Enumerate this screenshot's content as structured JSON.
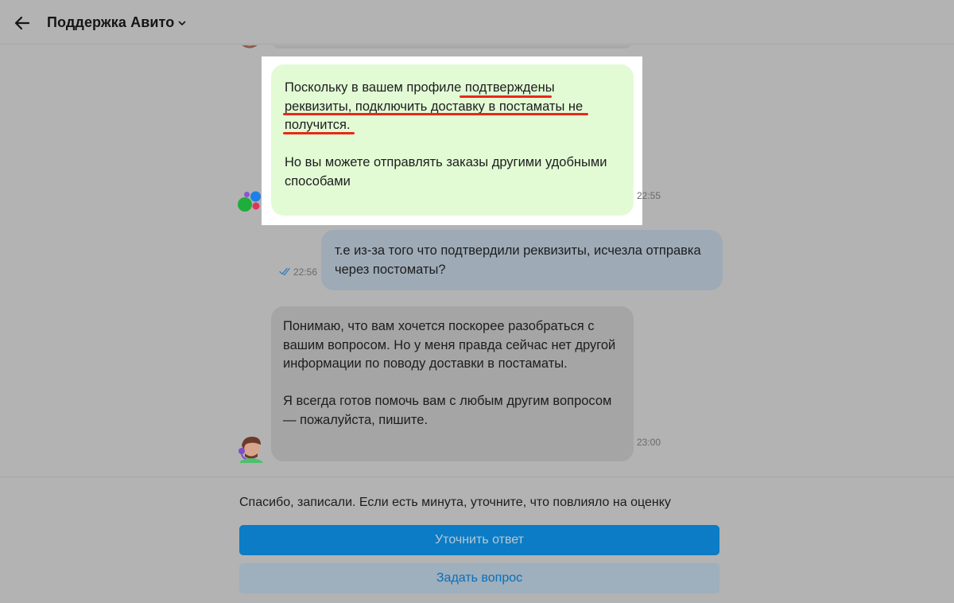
{
  "header": {
    "title": "Поддержка Авито"
  },
  "messages": [
    {
      "sender": "support",
      "paragraphs": [
        "Поскольку в вашем профиле подтверждены реквизиты, подключить доставку в постаматы не получится.",
        "Но вы можете отправлять заказы другими удобными способами"
      ],
      "time": "22:55"
    },
    {
      "sender": "user",
      "paragraphs": [
        "т.е из-за того что подтвердили реквизиты, исчезла отправка через постоматы?"
      ],
      "time": "22:56"
    },
    {
      "sender": "agent",
      "paragraphs": [
        "Понимаю, что вам хочется поскорее разобраться с вашим вопросом. Но у меня правда сейчас нет другой информации по поводу доставки в постаматы.",
        "Я всегда готов помочь вам с любым другим вопросом — пожалуйста, пишите."
      ],
      "time": "23:00"
    }
  ],
  "footer": {
    "feedback_text": "Спасибо, записали. Если есть минута, уточните, что повлияло на оценку",
    "primary_button": "Уточнить ответ",
    "secondary_button": "Задать вопрос"
  },
  "colors": {
    "highlight_underline": "#e8281a",
    "support_bubble": "#e2fbd5",
    "user_bubble": "#9eabb7",
    "agent_bubble": "#a5a5a5",
    "primary": "#0b7cc5"
  }
}
